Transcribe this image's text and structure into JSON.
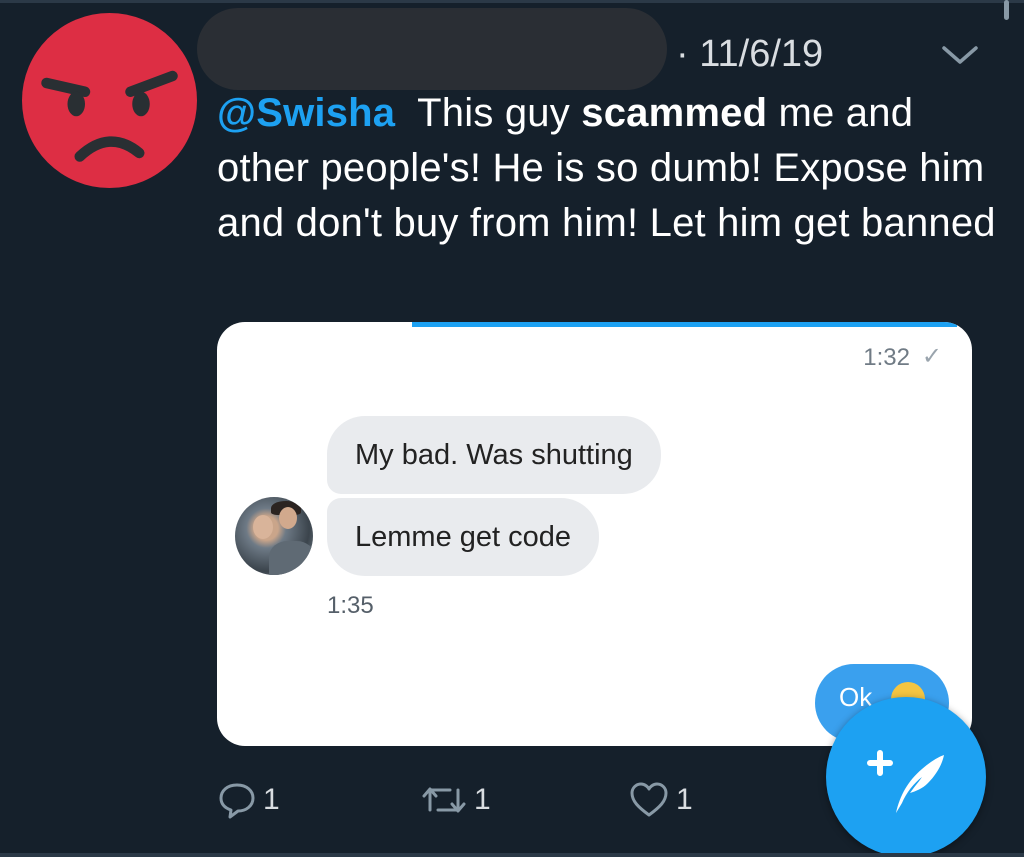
{
  "tweet": {
    "date": "· 11/6/19",
    "mention": "@Swisha",
    "text_part1": "This guy ",
    "text_bold": "scammed",
    "text_part2": " me and other people's! He is so dumb! Expose him and don't buy from him! Let him get banned"
  },
  "media": {
    "time_top": "1:32",
    "check_glyph": "✓",
    "messages": [
      {
        "text": "My bad. Was shutting"
      },
      {
        "text": "Lemme get code"
      }
    ],
    "time_received": "1:35",
    "sent_preview": "Ok"
  },
  "actions": {
    "reply_count": "1",
    "retweet_count": "1",
    "like_count": "1"
  },
  "icons": {
    "avatar": "angry-face-emoji-icon",
    "chevron": "chevron-down-icon",
    "reply": "reply-icon",
    "retweet": "retweet-icon",
    "like": "heart-icon",
    "compose": "compose-tweet-icon"
  },
  "colors": {
    "background": "#15202b",
    "accent": "#1da1f2",
    "emoji_red": "#dd2e44"
  }
}
